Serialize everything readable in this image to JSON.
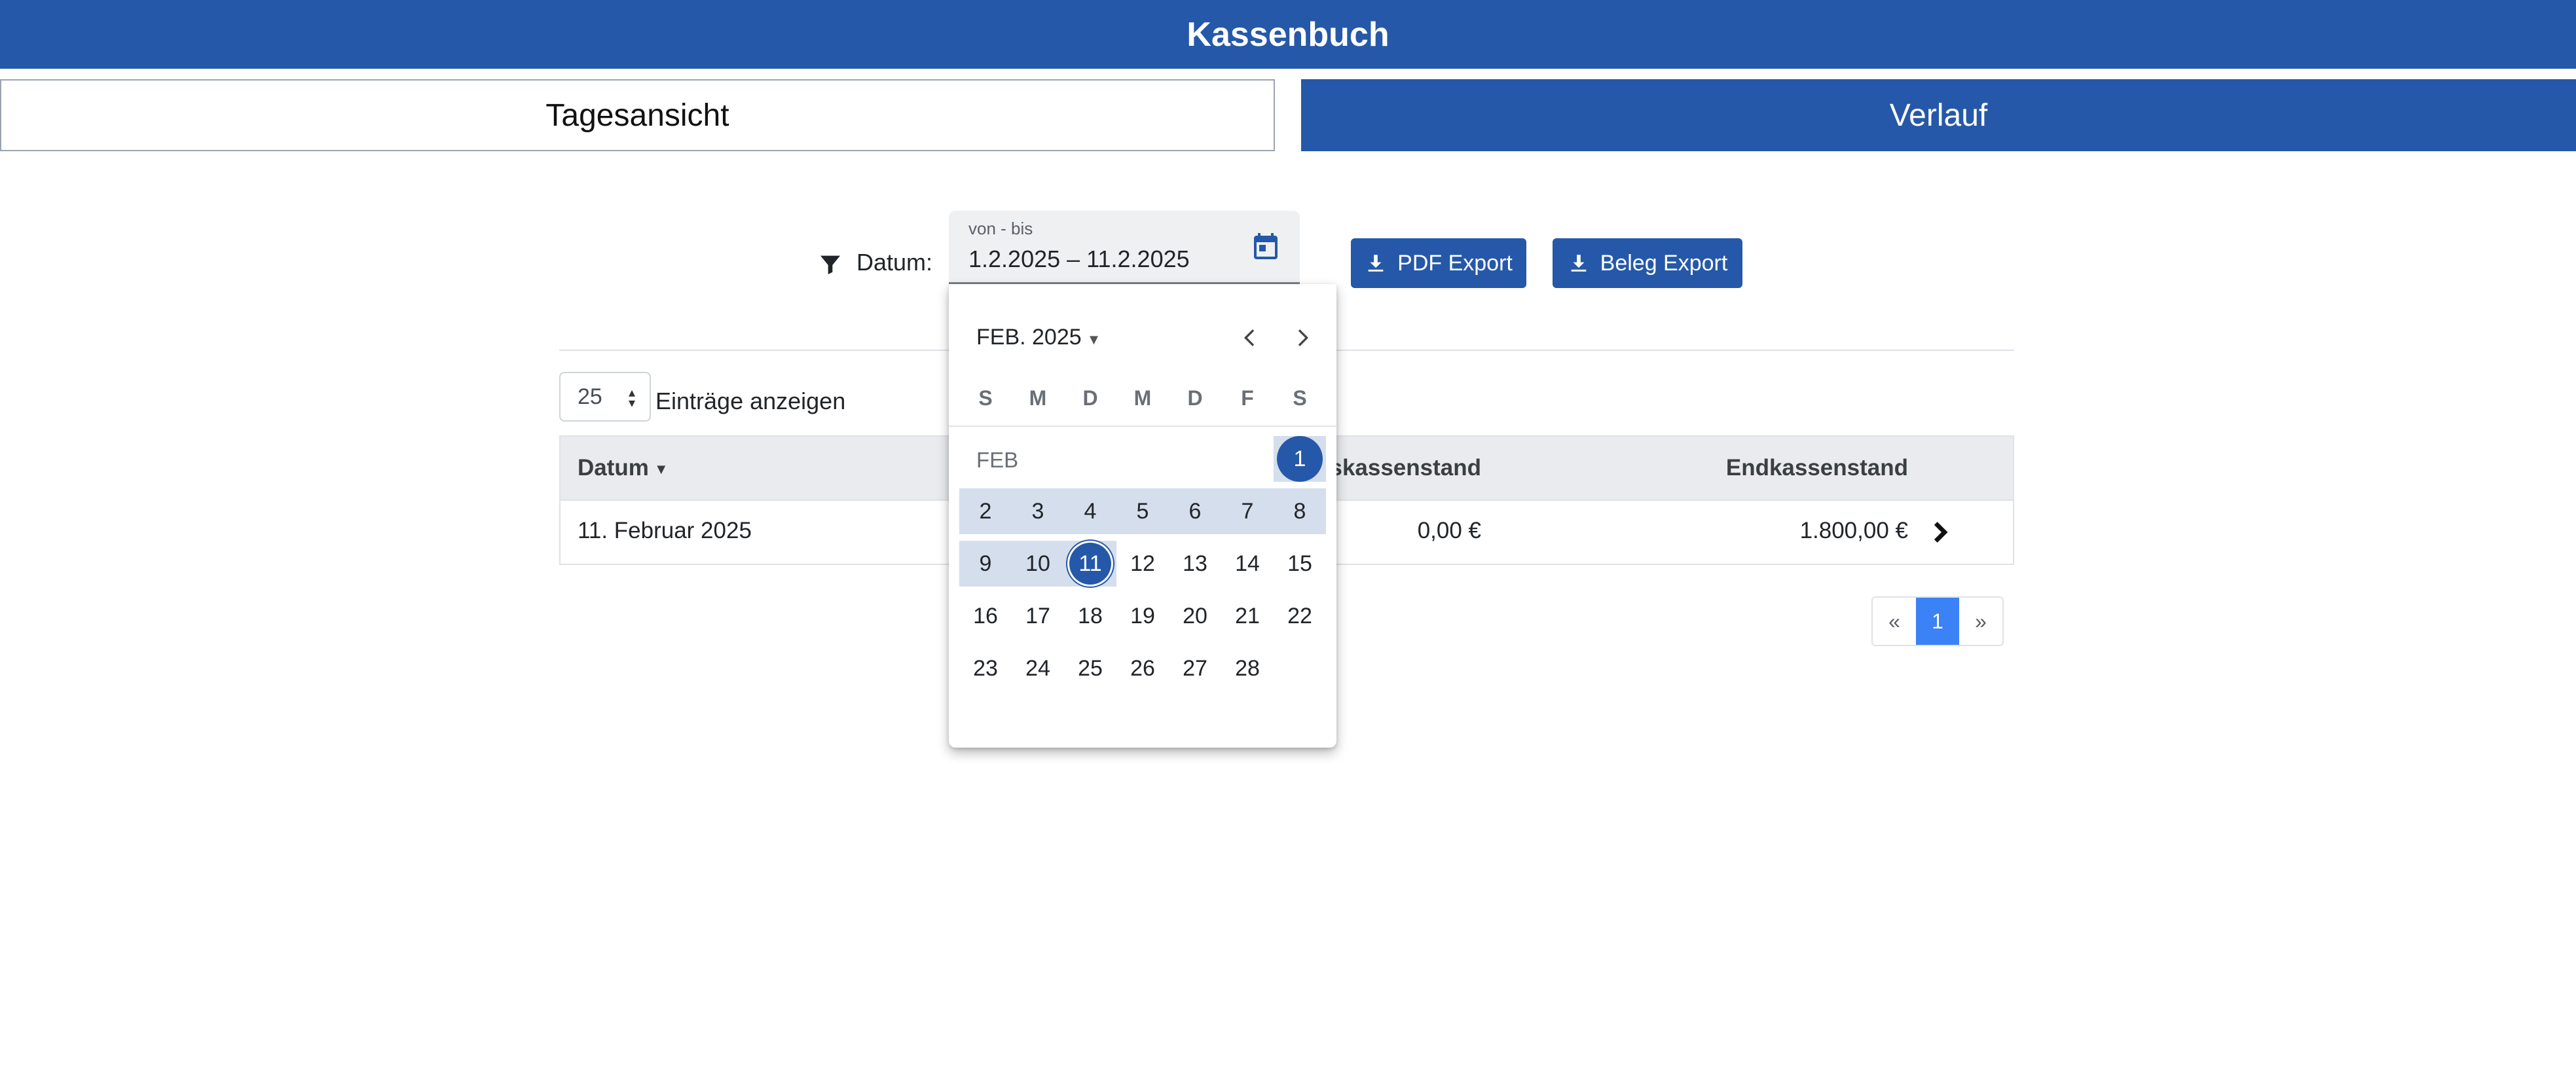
{
  "header": {
    "title": "Kassenbuch"
  },
  "tabs": {
    "daily": "Tagesansicht",
    "history": "Verlauf"
  },
  "filter": {
    "label": "Datum:",
    "date_range_label": "von - bis",
    "date_range_value": "1.2.2025 – 11.2.2025"
  },
  "exports": {
    "pdf": "PDF Export",
    "beleg": "Beleg Export"
  },
  "listing": {
    "page_size": "25",
    "entries_label": "Einträge anzeigen"
  },
  "table": {
    "headers": {
      "datum": "Datum",
      "anfang": "gskassenstand",
      "end": "Endkassenstand"
    },
    "rows": [
      {
        "datum": "11. Februar 2025",
        "anfang": "0,00 €",
        "end": "1.800,00 €"
      }
    ]
  },
  "pagination": {
    "prev": "«",
    "current": "1",
    "next": "»"
  },
  "datepicker": {
    "month_label": "FEB. 2025",
    "mini_month": "FEB",
    "weekdays": [
      "S",
      "M",
      "D",
      "M",
      "D",
      "F",
      "S"
    ],
    "range_start": 1,
    "range_end": 11,
    "days": [
      "1",
      "2",
      "3",
      "4",
      "5",
      "6",
      "7",
      "8",
      "9",
      "10",
      "11",
      "12",
      "13",
      "14",
      "15",
      "16",
      "17",
      "18",
      "19",
      "20",
      "21",
      "22",
      "23",
      "24",
      "25",
      "26",
      "27",
      "28"
    ]
  },
  "colors": {
    "primary": "#2558a8",
    "range_band": "#d5deed",
    "pagination_active": "#3b82f6"
  },
  "icons": {
    "filter": "filter-icon",
    "calendar": "calendar-icon",
    "download": "download-icon",
    "chevron_left": "chevron-left-icon",
    "chevron_right": "chevron-right-icon"
  }
}
